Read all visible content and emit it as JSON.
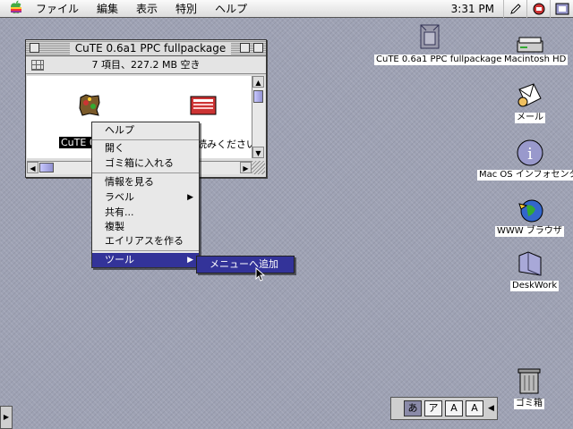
{
  "menubar": {
    "apple_icon": "apple-logo-icon",
    "items": [
      "ファイル",
      "編集",
      "表示",
      "特別",
      "ヘルプ"
    ],
    "clock": "3:31 PM",
    "right_icons": [
      "pen-icon",
      "finder-app-icon"
    ]
  },
  "window": {
    "title": "CuTE 0.6a1 PPC fullpackage",
    "info": "7 項目、227.2 MB 空き",
    "items": [
      {
        "label": "CuTE 0.",
        "icon": "application-icon"
      },
      {
        "label": "読みください",
        "icon": "document-icon"
      }
    ]
  },
  "context_menu": {
    "help": "ヘルプ",
    "open": "開く",
    "trash": "ゴミ箱に入れる",
    "get_info": "情報を見る",
    "label": "ラベル",
    "sharing": "共有...",
    "duplicate": "複製",
    "make_alias": "エイリアスを作る",
    "tools": "ツール"
  },
  "submenu": {
    "add_to_menu": "メニューへ追加"
  },
  "desktop": {
    "icons": [
      {
        "label": "CuTE 0.6a1 PPC fullpackage",
        "icon": "package-icon"
      },
      {
        "label": "Macintosh HD",
        "icon": "hard-disk-icon"
      },
      {
        "label": "メール",
        "icon": "mail-icon"
      },
      {
        "label": "Mac OS インフォセンタ",
        "icon": "info-center-icon"
      },
      {
        "label": "WWW ブラウザ",
        "icon": "browser-icon"
      },
      {
        "label": "DeskWork",
        "icon": "folder-icon"
      },
      {
        "label": "ゴミ箱",
        "icon": "trash-icon"
      }
    ]
  },
  "control_strip": {
    "keys": [
      "あ",
      "ア",
      "A",
      "A"
    ]
  }
}
